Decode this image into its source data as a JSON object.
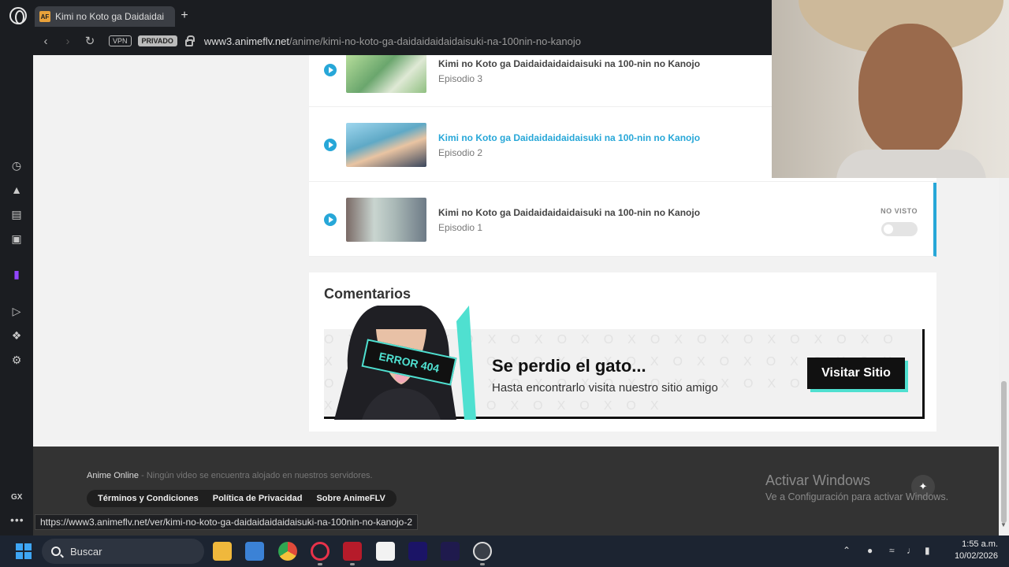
{
  "browser": {
    "tab_title": "Kimi no Koto ga Daidaidai",
    "tab_favicon": "AF",
    "new_tab": "+",
    "vpn_badge": "VPN",
    "private_badge": "PRIVADO",
    "url_domain": "www3.animeflv.net",
    "url_path": "/anime/kimi-no-koto-ga-daidaidaidaidaisuki-na-100nin-no-kanojo",
    "status_url": "https://www3.animeflv.net/ver/kimi-no-koto-ga-daidaidaidaidaisuki-na-100nin-no-kanojo-2"
  },
  "sidebar": {
    "items": [
      "speed-dial-icon",
      "player-icon",
      "wallpaper-icon",
      "messenger-icon",
      "twitch-icon",
      "video-icon",
      "extensions-icon",
      "settings-icon"
    ],
    "gx_label": "GX",
    "more_label": "•••"
  },
  "episodes": [
    {
      "title": "Kimi no Koto ga Daidaidaidaidaisuki na 100-nin no Kanojo",
      "number": "Episodio 3",
      "active": false
    },
    {
      "title": "Kimi no Koto ga Daidaidaidaidaisuki na 100-nin no Kanojo",
      "number": "Episodio 2",
      "active": true
    },
    {
      "title": "Kimi no Koto ga Daidaidaidaidaisuki na 100-nin no Kanojo",
      "number": "Episodio 1",
      "active": false,
      "status": "NO VISTO"
    }
  ],
  "comments": {
    "title": "Comentarios",
    "banner_tag": "ERROR 404",
    "banner_title": "Se perdio el gato...",
    "banner_subtitle": "Hasta encontrarlo visita nuestro sitio amigo",
    "banner_button": "Visitar Sitio"
  },
  "footer": {
    "brand": "Anime Online",
    "disclaimer": " - Ningún video se encuentra alojado en nuestros servidores.",
    "links": [
      "Términos y Condiciones",
      "Política de Privacidad",
      "Sobre AnimeFLV"
    ]
  },
  "windows_activation": {
    "title": "Activar Windows",
    "subtitle": "Ve a Configuración para activar Windows."
  },
  "taskbar": {
    "search_placeholder": "Buscar",
    "apps": [
      "file-explorer-icon",
      "store-icon",
      "chrome-icon",
      "opera-gx-icon",
      "voicemeeter-icon",
      "notion-icon",
      "premiere-icon",
      "after-effects-icon",
      "obs-icon"
    ],
    "time": "1:55 a.m.",
    "date": "10/02/2026"
  },
  "colors": {
    "accent": "#27a7d8",
    "banner_accent": "#4fe0d0"
  }
}
